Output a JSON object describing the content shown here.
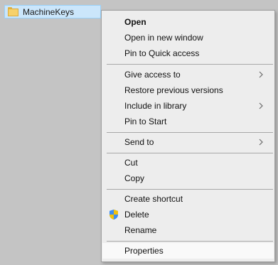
{
  "folder": {
    "name": "MachineKeys",
    "icon": "folder-icon"
  },
  "menu": {
    "open": "Open",
    "open_new_window": "Open in new window",
    "pin_quick_access": "Pin to Quick access",
    "give_access": "Give access to",
    "restore_versions": "Restore previous versions",
    "include_library": "Include in library",
    "pin_start": "Pin to Start",
    "send_to": "Send to",
    "cut": "Cut",
    "copy": "Copy",
    "create_shortcut": "Create shortcut",
    "delete": "Delete",
    "rename": "Rename",
    "properties": "Properties"
  },
  "icons": {
    "submenu": "chevron-right-icon",
    "delete": "uac-shield-icon"
  },
  "colors": {
    "selection_bg": "#cbe6fb",
    "menu_bg": "#ededed",
    "hover_bg": "#f9f9f9"
  }
}
